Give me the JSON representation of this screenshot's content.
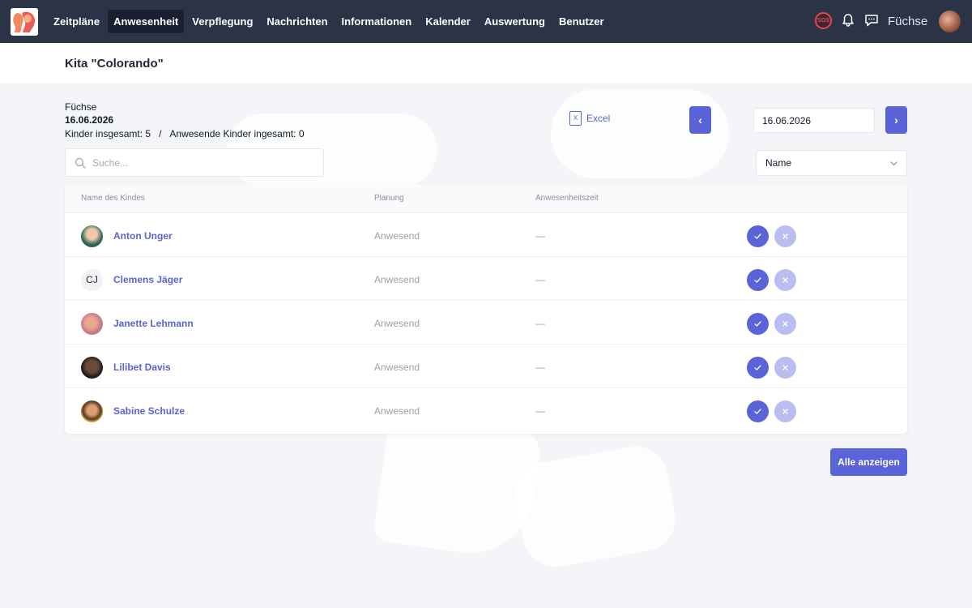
{
  "nav": {
    "items": [
      {
        "label": "Zeitpläne",
        "active": false
      },
      {
        "label": "Anwesenheit",
        "active": true
      },
      {
        "label": "Verpflegung",
        "active": false
      },
      {
        "label": "Nachrichten",
        "active": false
      },
      {
        "label": "Informationen",
        "active": false
      },
      {
        "label": "Kalender",
        "active": false
      },
      {
        "label": "Auswertung",
        "active": false
      },
      {
        "label": "Benutzer",
        "active": false
      }
    ],
    "sos_label": "SOS",
    "group_label": "Füchse"
  },
  "header": {
    "title": "Kita \"Colorando\""
  },
  "info": {
    "group_name": "Füchse",
    "date": "16.06.2026",
    "children_total": "Kinder insgesamt: 5",
    "separator": "/",
    "present_total": "Anwesende Kinder ingesamt: 0"
  },
  "toolbar": {
    "excel_label": "Excel",
    "prev_label": "‹",
    "next_label": "›",
    "date_value": "16.06.2026",
    "search_placeholder": "Suche...",
    "sort_value": "Name"
  },
  "table": {
    "headers": [
      "Name des Kindes",
      "Planung",
      "Anwesenheitszeit"
    ],
    "rows": [
      {
        "name": "Anton Unger",
        "planung": "Anwesend",
        "zeit": "—",
        "initials": ""
      },
      {
        "name": "Clemens Jäger",
        "planung": "Anwesend",
        "zeit": "—",
        "initials": "CJ"
      },
      {
        "name": "Janette Lehmann",
        "planung": "Anwesend",
        "zeit": "—",
        "initials": ""
      },
      {
        "name": "Lilibet Davis",
        "planung": "Anwesend",
        "zeit": "—",
        "initials": ""
      },
      {
        "name": "Sabine Schulze",
        "planung": "Anwesend",
        "zeit": "—",
        "initials": ""
      }
    ]
  },
  "footer": {
    "show_all_label": "Alle anzeigen"
  },
  "colors": {
    "accent": "#5b63d9",
    "accent_light": "#b9bdf1",
    "nav_bg": "#2b3446",
    "sos": "#e5484d"
  }
}
